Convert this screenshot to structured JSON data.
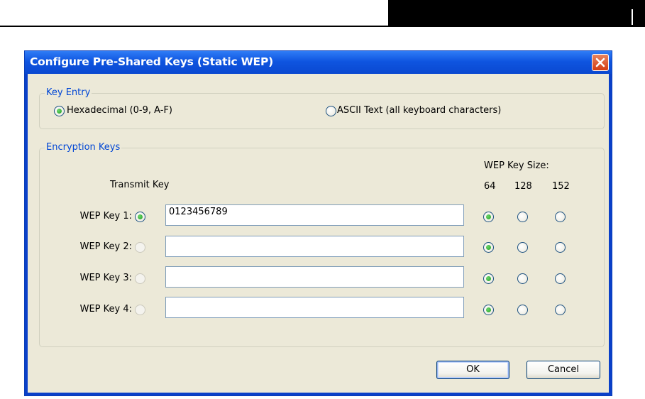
{
  "dialog": {
    "title": "Configure Pre-Shared Keys (Static WEP)"
  },
  "key_entry": {
    "legend": "Key Entry",
    "options": [
      {
        "label": "Hexadecimal (0-9, A-F)",
        "checked": true
      },
      {
        "label": "ASCII Text (all keyboard characters)",
        "checked": false
      }
    ]
  },
  "encryption_keys": {
    "legend": "Encryption Keys",
    "transmit_key_label": "Transmit Key",
    "size_header": "WEP Key Size:",
    "sizes": [
      "64",
      "128",
      "152"
    ],
    "keys": [
      {
        "label": "WEP Key 1:",
        "value": "0123456789",
        "transmit": true,
        "size": "64"
      },
      {
        "label": "WEP Key 2:",
        "value": "",
        "transmit": false,
        "size": "64"
      },
      {
        "label": "WEP Key 3:",
        "value": "",
        "transmit": false,
        "size": "64"
      },
      {
        "label": "WEP Key 4:",
        "value": "",
        "transmit": false,
        "size": "64"
      }
    ]
  },
  "buttons": {
    "ok": "OK",
    "cancel": "Cancel"
  },
  "colors": {
    "titlebar": "#0a48d0",
    "dialog_bg": "#ece9d8",
    "legend_text": "#0046d5",
    "radio_dot": "#21a121"
  }
}
